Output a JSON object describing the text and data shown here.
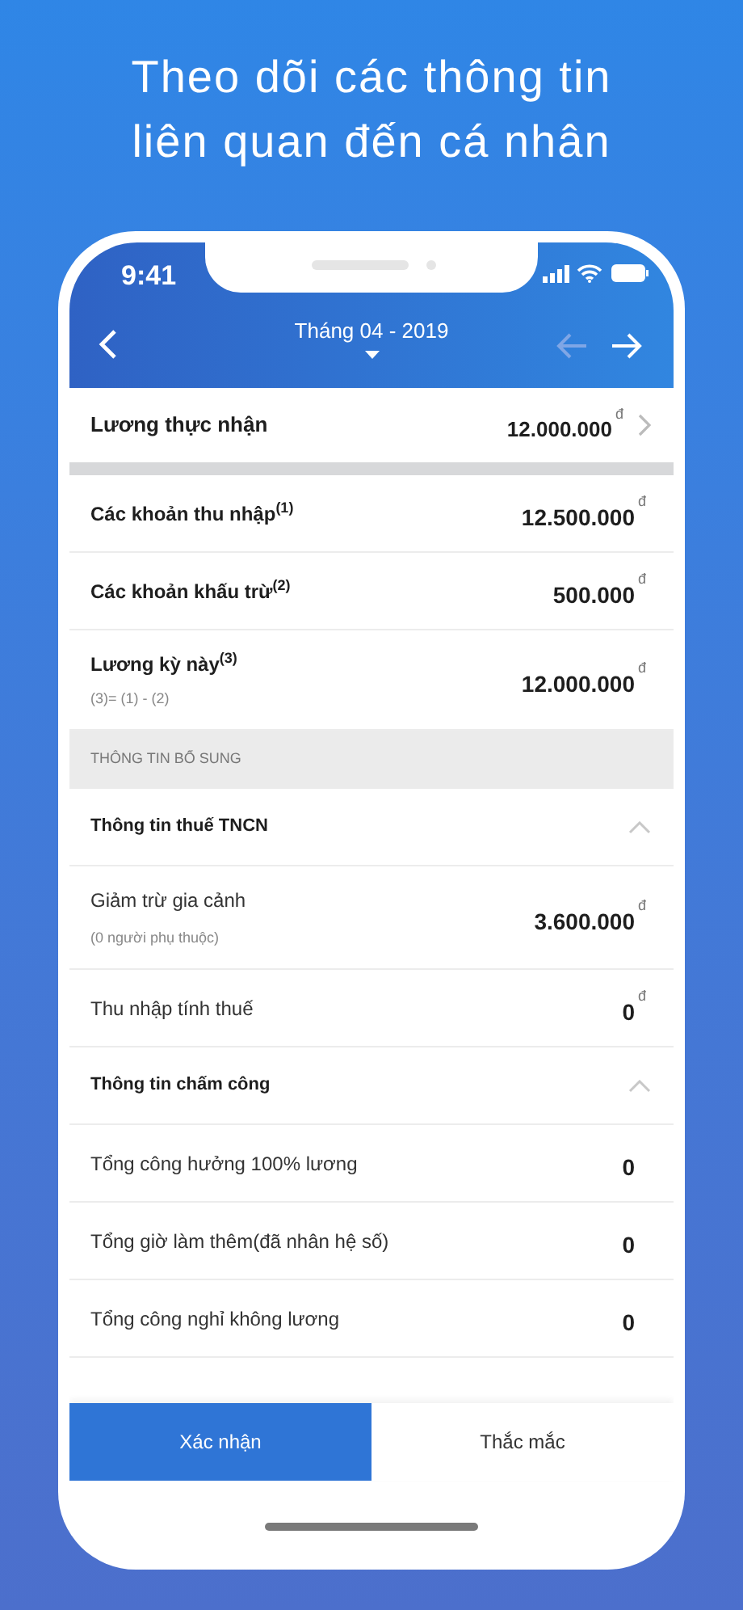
{
  "headline": [
    "Theo dõi các thông tin",
    "liên quan đến cá nhân"
  ],
  "status_bar": {
    "time": "9:41"
  },
  "header": {
    "title": "Tháng 04 - 2019",
    "prev_month": {
      "disabled": true
    },
    "next_month": {
      "disabled": false
    }
  },
  "summary": {
    "label": "Lương thực nhận",
    "value": "12.000.000",
    "currency": "đ"
  },
  "main_rows": [
    {
      "label": "Các khoản thu nhập",
      "note": "(1)",
      "value": "12.500.000",
      "currency": "đ"
    },
    {
      "label": "Các khoản khấu trừ",
      "note": "(2)",
      "value": "500.000",
      "currency": "đ"
    },
    {
      "label": "Lương kỳ này",
      "note": "(3)",
      "sub": "(3)= (1) - (2)",
      "value": "12.000.000",
      "currency": "đ"
    }
  ],
  "section_title": "THÔNG TIN BỔ SUNG",
  "groups": [
    {
      "title": "Thông tin thuế TNCN",
      "expanded": true,
      "rows": [
        {
          "label": "Giảm trừ gia cảnh",
          "sub": "(0 người phụ thuộc)",
          "value": "3.600.000",
          "currency": "đ"
        },
        {
          "label": "Thu nhập tính thuế",
          "value": "0",
          "currency": "đ"
        }
      ]
    },
    {
      "title": "Thông tin chấm công",
      "expanded": true,
      "rows": [
        {
          "label": "Tổng công hưởng 100% lương",
          "value": "0"
        },
        {
          "label": "Tổng giờ làm thêm(đã nhân hệ số)",
          "value": "0"
        },
        {
          "label": "Tổng công nghỉ không lương",
          "value": "0"
        }
      ]
    }
  ],
  "buttons": [
    {
      "label": "Xác nhận",
      "kind": "primary"
    },
    {
      "label": "Thắc mắc",
      "kind": "secondary"
    }
  ]
}
